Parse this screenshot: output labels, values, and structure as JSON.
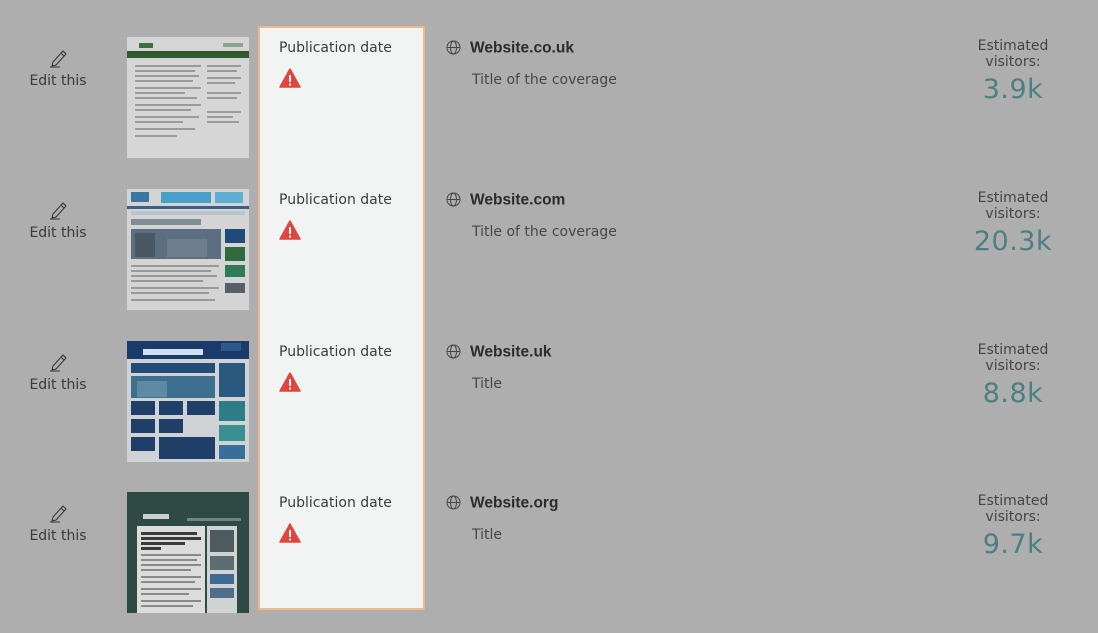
{
  "edit_label": "Edit this",
  "publication_label": "Publication date",
  "visitors_label": "Estimated visitors:",
  "colors": {
    "background": "#aeaeae",
    "highlight_border": "#f0b98a",
    "warning": "#e0453f",
    "visitor_value": "#4c7f85"
  },
  "icons": {
    "edit": "pencil-icon",
    "warning": "warning-icon",
    "site": "globe-icon"
  },
  "rows": [
    {
      "site": "Website.co.uk",
      "title": "Title of the coverage",
      "visitors": "3.9k"
    },
    {
      "site": "Website.com",
      "title": "Title of the coverage",
      "visitors": "20.3k"
    },
    {
      "site": "Website.uk",
      "title": "Title",
      "visitors": "8.8k"
    },
    {
      "site": "Website.org",
      "title": "Title",
      "visitors": "9.7k"
    }
  ]
}
